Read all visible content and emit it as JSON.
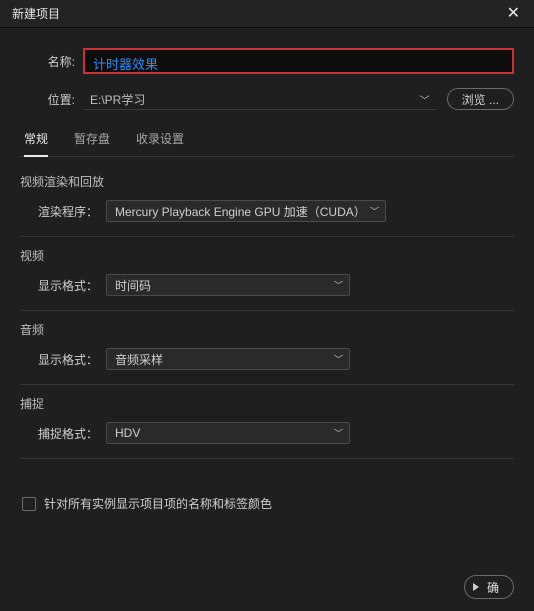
{
  "titlebar": {
    "title": "新建项目"
  },
  "name": {
    "label": "名称:",
    "value": "计时器效果"
  },
  "location": {
    "label": "位置:",
    "value": "E:\\PR学习",
    "browse": "浏览 ..."
  },
  "tabs": {
    "general": "常规",
    "scratch": "暂存盘",
    "ingest": "收录设置"
  },
  "render": {
    "section": "视频渲染和回放",
    "label": "渲染程序：",
    "value": "Mercury Playback Engine GPU 加速（CUDA）"
  },
  "video": {
    "section": "视频",
    "label": "显示格式：",
    "value": "时间码"
  },
  "audio": {
    "section": "音频",
    "label": "显示格式：",
    "value": "音频采样"
  },
  "capture": {
    "section": "捕捉",
    "label": "捕捉格式：",
    "value": "HDV"
  },
  "checkbox": {
    "label": "针对所有实例显示项目项的名称和标签颜色"
  },
  "footer": {
    "ok": "确"
  }
}
